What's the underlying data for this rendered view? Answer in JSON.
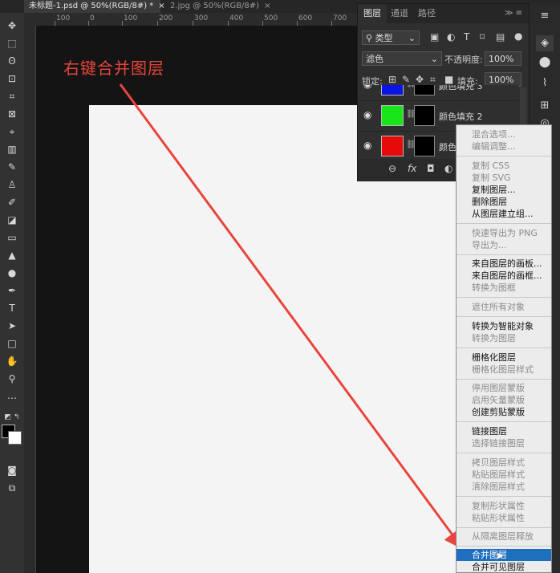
{
  "tabs": [
    {
      "label": "未标题-1.psd @ 50%(RGB/8#) *",
      "close": "×"
    },
    {
      "label": "2.jpg @ 50%(RGB/8#)",
      "close": "×"
    }
  ],
  "ruler": {
    "ticks": [
      "100",
      "0",
      "100",
      "200",
      "300",
      "400",
      "500",
      "600",
      "700"
    ]
  },
  "annotation": {
    "text": "右键合并图层",
    "color": "#e8453c"
  },
  "layers_panel": {
    "tabs": [
      "图层",
      "通道",
      "路径"
    ],
    "filter_kind": "类型",
    "blend_mode": "滤色",
    "opacity_label": "不透明度:",
    "opacity_value": "100%",
    "lock_label": "锁定:",
    "fill_label": "填充:",
    "fill_value": "100%",
    "layers": [
      {
        "name": "颜色填充 3",
        "color": "#0a14e6"
      },
      {
        "name": "颜色填充 2",
        "color": "#19e619"
      },
      {
        "name": "颜色填充 1",
        "color": "#e60a0a"
      }
    ]
  },
  "context_menu": {
    "items": [
      {
        "label": "混合选项...",
        "enabled": false
      },
      {
        "label": "编辑调整...",
        "enabled": false
      },
      {
        "label": "复制 CSS",
        "enabled": false
      },
      {
        "label": "复制 SVG",
        "enabled": false
      },
      {
        "label": "复制图层...",
        "enabled": true
      },
      {
        "label": "删除图层",
        "enabled": true
      },
      {
        "label": "从图层建立组...",
        "enabled": true
      },
      {
        "label": "快速导出为 PNG",
        "enabled": false
      },
      {
        "label": "导出为...",
        "enabled": false
      },
      {
        "label": "来自图层的画板...",
        "enabled": true
      },
      {
        "label": "来自图层的画框...",
        "enabled": true
      },
      {
        "label": "转换为图框",
        "enabled": false
      },
      {
        "label": "遮住所有对象",
        "enabled": false
      },
      {
        "label": "转换为智能对象",
        "enabled": true
      },
      {
        "label": "转换为图层",
        "enabled": false
      },
      {
        "label": "栅格化图层",
        "enabled": true
      },
      {
        "label": "栅格化图层样式",
        "enabled": false
      },
      {
        "label": "停用图层蒙版",
        "enabled": false
      },
      {
        "label": "启用矢量蒙版",
        "enabled": false
      },
      {
        "label": "创建剪贴蒙版",
        "enabled": true
      },
      {
        "label": "链接图层",
        "enabled": true
      },
      {
        "label": "选择链接图层",
        "enabled": false
      },
      {
        "label": "拷贝图层样式",
        "enabled": false
      },
      {
        "label": "粘贴图层样式",
        "enabled": false
      },
      {
        "label": "清除图层样式",
        "enabled": false
      },
      {
        "label": "复制形状属性",
        "enabled": false
      },
      {
        "label": "粘贴形状属性",
        "enabled": false
      },
      {
        "label": "从隔离图层释放",
        "enabled": false
      },
      {
        "label": "合并图层",
        "enabled": true,
        "highlighted": true
      },
      {
        "label": "合并可见图层",
        "enabled": true
      }
    ]
  }
}
